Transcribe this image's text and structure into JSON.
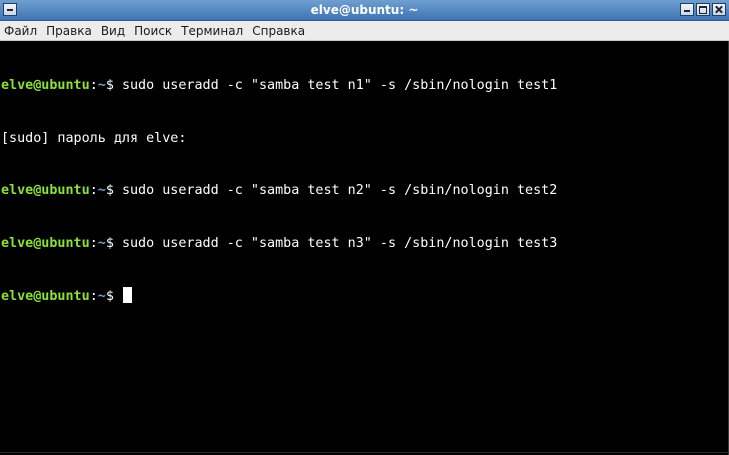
{
  "window": {
    "title": "elve@ubuntu: ~"
  },
  "menubar": {
    "items": [
      "Файл",
      "Правка",
      "Вид",
      "Поиск",
      "Терминал",
      "Справка"
    ]
  },
  "terminal": {
    "lines": [
      {
        "type": "prompt",
        "user": "elve@ubuntu",
        "sep": ":",
        "path": "~",
        "symbol": "$ ",
        "command": "sudo useradd -c \"samba test n1\" -s /sbin/nologin test1"
      },
      {
        "type": "output",
        "text": "[sudo] пароль для elve:"
      },
      {
        "type": "prompt",
        "user": "elve@ubuntu",
        "sep": ":",
        "path": "~",
        "symbol": "$ ",
        "command": "sudo useradd -c \"samba test n2\" -s /sbin/nologin test2"
      },
      {
        "type": "prompt",
        "user": "elve@ubuntu",
        "sep": ":",
        "path": "~",
        "symbol": "$ ",
        "command": "sudo useradd -c \"samba test n3\" -s /sbin/nologin test3"
      },
      {
        "type": "prompt",
        "user": "elve@ubuntu",
        "sep": ":",
        "path": "~",
        "symbol": "$ ",
        "command": ""
      }
    ]
  },
  "colors": {
    "prompt_user": "#8ae234",
    "prompt_path": "#729fcf",
    "background": "#000000",
    "foreground": "#ffffff",
    "titlebar": "#4f86c6"
  }
}
